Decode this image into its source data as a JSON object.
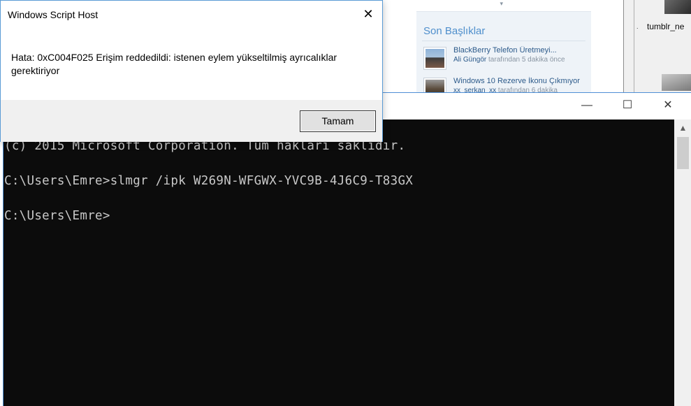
{
  "background": {
    "sidebar": {
      "title": "Son Başlıklar",
      "posts": [
        {
          "title": "BlackBerry Telefon Üretmeyi...",
          "author": "Ali Güngör",
          "meta": "tarafından 5 dakika önce"
        },
        {
          "title": "Windows 10 Rezerve İkonu Çıkmıyor",
          "author": "xx_serkan_xx",
          "meta": "tarafından 6 dakika"
        }
      ]
    },
    "desktop_label": "tumblr_ne"
  },
  "console": {
    "window_buttons": {
      "minimize": "—",
      "maximize": "☐",
      "close": "✕"
    },
    "lines": [
      "(c) 2015 Microsoft Corporation. Tüm hakları saklıdır.",
      "C:\\Users\\Emre>slmgr /ipk W269N-WFGWX-YVC9B-4J6C9-T83GX",
      "C:\\Users\\Emre>"
    ]
  },
  "dialog": {
    "title": "Windows Script Host",
    "message": "Hata: 0xC004F025 Erişim reddedildi: istenen eylem yükseltilmiş ayrıcalıklar gerektiriyor",
    "ok_label": "Tamam",
    "close_glyph": "✕"
  }
}
